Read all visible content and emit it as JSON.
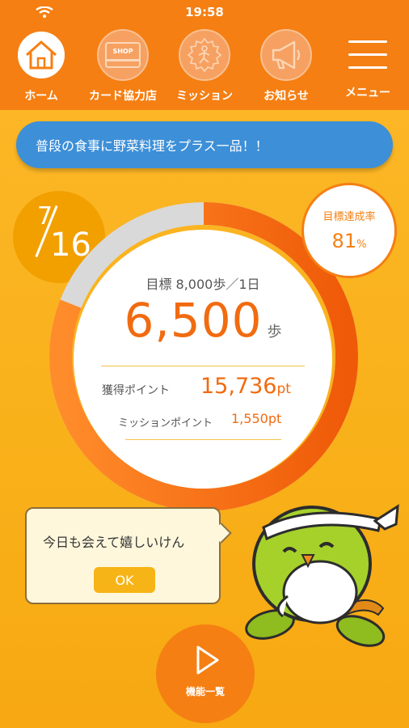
{
  "status_bar": {
    "time": "19:58",
    "wifi_icon": "wifi-icon"
  },
  "nav": [
    {
      "id": "home",
      "label": "ホーム",
      "icon": "home-icon",
      "active": true
    },
    {
      "id": "card",
      "label": "カード協力店",
      "icon": "shop-card-icon",
      "shop_text": "SHOP"
    },
    {
      "id": "mission",
      "label": "ミッション",
      "icon": "mission-runner-icon"
    },
    {
      "id": "news",
      "label": "お知らせ",
      "icon": "megaphone-icon"
    },
    {
      "id": "menu",
      "label": "メニュー",
      "icon": "hamburger-icon"
    }
  ],
  "tip": "普段の食事に野菜料理をプラス一品！！",
  "date": {
    "month": "7",
    "day": "16"
  },
  "achievement": {
    "label": "目標達成率",
    "value": "81",
    "unit": "%"
  },
  "steps": {
    "goal_text": "目標 8,000歩／1日",
    "value": "6,500",
    "unit": "歩",
    "progress": 0.81
  },
  "points": {
    "earned_label": "獲得ポイント",
    "earned_value": "15,736",
    "earned_unit": "pt",
    "mission_label": "ミッションポイント",
    "mission_value": "1,550",
    "mission_unit": "pt"
  },
  "bubble": {
    "text": "今日も会えて嬉しいけん",
    "ok_label": "OK"
  },
  "features": {
    "label": "機能一覧",
    "icon": "play-icon"
  },
  "colors": {
    "accent": "#f57f13",
    "ring_light": "#ff8c2a",
    "ring_dark": "#ef5a08",
    "banner": "#3d8fd8",
    "ring_track": "#d9d9d9"
  }
}
